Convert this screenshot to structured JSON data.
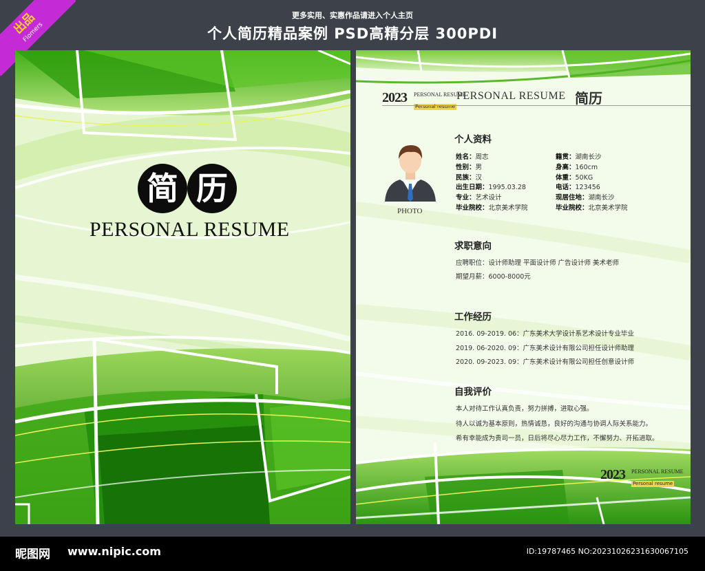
{
  "badge": {
    "main": "出品",
    "sub": "Flomers"
  },
  "header": {
    "subtitle": "更多实用、实惠作品请进入个人主页",
    "title": "个人简历精品案例 PSD高精分层 300PDI"
  },
  "cover": {
    "char1": "简",
    "char2": "历",
    "subtitle": "PERSONAL RESUME"
  },
  "resume": {
    "year": "2023",
    "small_en": "PERSONAL RESUME",
    "small_sub": "Personal resume",
    "title_en": "PERSONAL RESUME",
    "title_cn": "简历",
    "photo_label": "PHOTO",
    "personal": {
      "heading": "个人资料",
      "left": [
        {
          "k": "姓名：",
          "v": "周志"
        },
        {
          "k": "性别：",
          "v": "男"
        },
        {
          "k": "民族：",
          "v": "汉"
        },
        {
          "k": "出生日期：",
          "v": "1995.03.28"
        },
        {
          "k": "专业：",
          "v": "艺术设计"
        },
        {
          "k": "毕业院校：",
          "v": "北京美术学院"
        }
      ],
      "right": [
        {
          "k": "籍贯：",
          "v": "湖南长沙"
        },
        {
          "k": "身高：",
          "v": "160cm"
        },
        {
          "k": "体重：",
          "v": "50KG"
        },
        {
          "k": "电话：",
          "v": "123456"
        },
        {
          "k": "现居住地：",
          "v": "湖南长沙"
        },
        {
          "k": "毕业院校：",
          "v": "北京美术学院"
        }
      ]
    },
    "intent": {
      "heading": "求职意向",
      "lines": [
        "应聘职位：设计师助理  平面设计师  广告设计师  美术老师",
        "期望月薪：6000-8000元"
      ]
    },
    "work": {
      "heading": "工作经历",
      "lines": [
        "2016. 09-2019. 06：广东美术大学设计系艺术设计专业毕业",
        "2019. 06-2020. 09：广东美术设计有限公司担任设计师助理",
        "2020. 09-2023. 09：广东美术设计有限公司担任创意设计师"
      ]
    },
    "self": {
      "heading": "自我评价",
      "lines": [
        "本人对待工作认真负责，努力拼搏，进取心强。",
        "待人以诚为基本原则，热情诚恳，良好的沟通与协调人际关系能力。",
        "希有幸能成为贵司一员，日后将尽心尽力工作，不懈努力、开拓进取。"
      ]
    },
    "footer_year": "2023",
    "footer_small_en": "PERSONAL RESUME",
    "footer_small_sub": "Personal resume"
  },
  "footer": {
    "logo": "昵图网",
    "url": "www.nipic.com",
    "id": "ID:19787465 NO:20231026231630067105"
  },
  "colors": {
    "background": "#3d414a",
    "green_dark": "#1f8a10",
    "green_mid": "#52b81e",
    "green_light": "#a6db6e",
    "highlight": "#f2d64a"
  }
}
